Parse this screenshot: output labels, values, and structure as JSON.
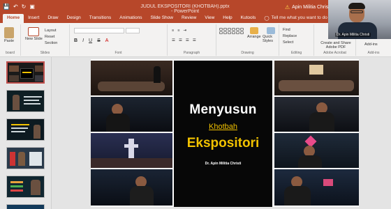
{
  "window": {
    "title": "JUDUL EKSPOSITORI (KHOTBAH).pptx - PowerPoint",
    "user_name": "Apin Militia Christi"
  },
  "tabs": [
    {
      "label": "Home",
      "active": true
    },
    {
      "label": "Insert"
    },
    {
      "label": "Draw"
    },
    {
      "label": "Design"
    },
    {
      "label": "Transitions"
    },
    {
      "label": "Animations"
    },
    {
      "label": "Slide Show"
    },
    {
      "label": "Review"
    },
    {
      "label": "View"
    },
    {
      "label": "Help"
    },
    {
      "label": "Kutools"
    }
  ],
  "tell_me": "Tell me what you want to do",
  "ribbon": {
    "clipboard": {
      "paste": "Paste",
      "cut": "Cut",
      "copy": "Copy",
      "label": "board"
    },
    "slides": {
      "new_slide": "New Slide",
      "layout": "Layout",
      "reset": "Reset",
      "section": "Section",
      "label": "Slides"
    },
    "font": {
      "label": "Font",
      "bold": "B",
      "italic": "I",
      "underline": "U",
      "strike": "S"
    },
    "paragraph": {
      "label": "Paragraph"
    },
    "drawing": {
      "shape_fill": "Shape Fill",
      "arrange": "Arrange",
      "quick_styles": "Quick Styles",
      "label": "Drawing"
    },
    "editing": {
      "find": "Find",
      "replace": "Replace",
      "select": "Select",
      "label": "Editing"
    },
    "adobe": {
      "create_share": "Create and Share Adobe PDF",
      "label": "Adobe Acrobat"
    },
    "addins": {
      "addins": "Add-ins",
      "label": "Add-ins"
    }
  },
  "webcam": {
    "name_tag": "Dr. Apin Militia Christi"
  },
  "thumbnails": [
    {
      "number": "1",
      "active": true
    },
    {
      "number": "2"
    },
    {
      "number": "3"
    },
    {
      "number": "4"
    },
    {
      "number": "5"
    },
    {
      "number": "6"
    }
  ],
  "slide": {
    "title_line1": "Menyusun",
    "title_line2": "Khotbah",
    "title_line3": "Ekspositori",
    "author": "Dr. Apin Militia Christi"
  },
  "colors": {
    "accent": "#b7472a",
    "title_text": "#ffffff",
    "highlight_text": "#f2c200",
    "slide_background": "#070707"
  }
}
